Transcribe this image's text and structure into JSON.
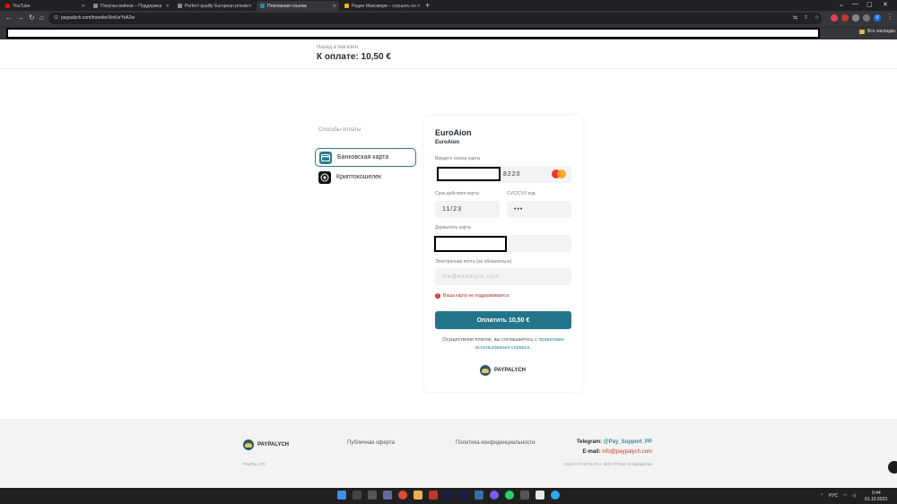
{
  "browser": {
    "tabs": [
      {
        "title": "YouTube",
        "color": "#ff0000"
      },
      {
        "title": "Покупка войнов – Поддержка",
        "color": "#888888"
      },
      {
        "title": "Perfect quality European private",
        "color": "#888888"
      },
      {
        "title": "Платежная ссылка",
        "color": "#2b8aa0"
      },
      {
        "title": "Радио Максимум – слушать он",
        "color": "#f5b800"
      }
    ],
    "new_tab": "+",
    "url": "paypalych.com/transfer/XnKxrYoA2w",
    "bookmarks_all": "Все закладки",
    "profile_initial": "V"
  },
  "checkout": {
    "back_link": "Назад в магазин",
    "amount_title": "К оплате: 10,50 €",
    "methods_label": "Способы оплаты",
    "methods": [
      {
        "label": "Банковская карта",
        "icon": "card-icon",
        "selected": true
      },
      {
        "label": "Криптокошелек",
        "icon": "crypto-wallet-icon",
        "selected": false
      }
    ],
    "merchant": "EuroAion",
    "merchant_sub": "EuroAion",
    "card_number_label": "Введите номер карты",
    "card_number_suffix": "8220",
    "expiry_label": "Срок действия карты",
    "expiry_value": "11/23",
    "cvc_label": "CVC/CVV код",
    "cvc_value": "•••",
    "holder_label": "Держатель карты",
    "email_label": "Электронная почта (не обязательно)",
    "email_placeholder": "me@example.com",
    "error_text": "Ваша карта не поддерживается",
    "pay_button": "Оплатить 10,50 €",
    "terms_text": "Осуществляя платеж, вы соглашаетесь с ",
    "terms_link": "правилами использования сервиса.",
    "brand": "PAYPALYCH"
  },
  "footer": {
    "brand": "PAYPALYCH",
    "company": "PayPay LTD",
    "offer": "Публичная оферта",
    "privacy": "Политика конфиденциальности",
    "telegram_label": "Telegram:",
    "telegram_value": "@Pay_Support_PP",
    "email_label": "E-mail:",
    "email_value": "info@paypalych.com",
    "copyright": "2023 © PAYPALYCH. ВСЕ ПРАВА ЗАЩИЩЕНЫ"
  },
  "taskbar": {
    "lang": "РУС",
    "time": "0:44",
    "date": "01.10.2023"
  },
  "colors": {
    "accent": "#23758a",
    "error": "#c0392b"
  }
}
